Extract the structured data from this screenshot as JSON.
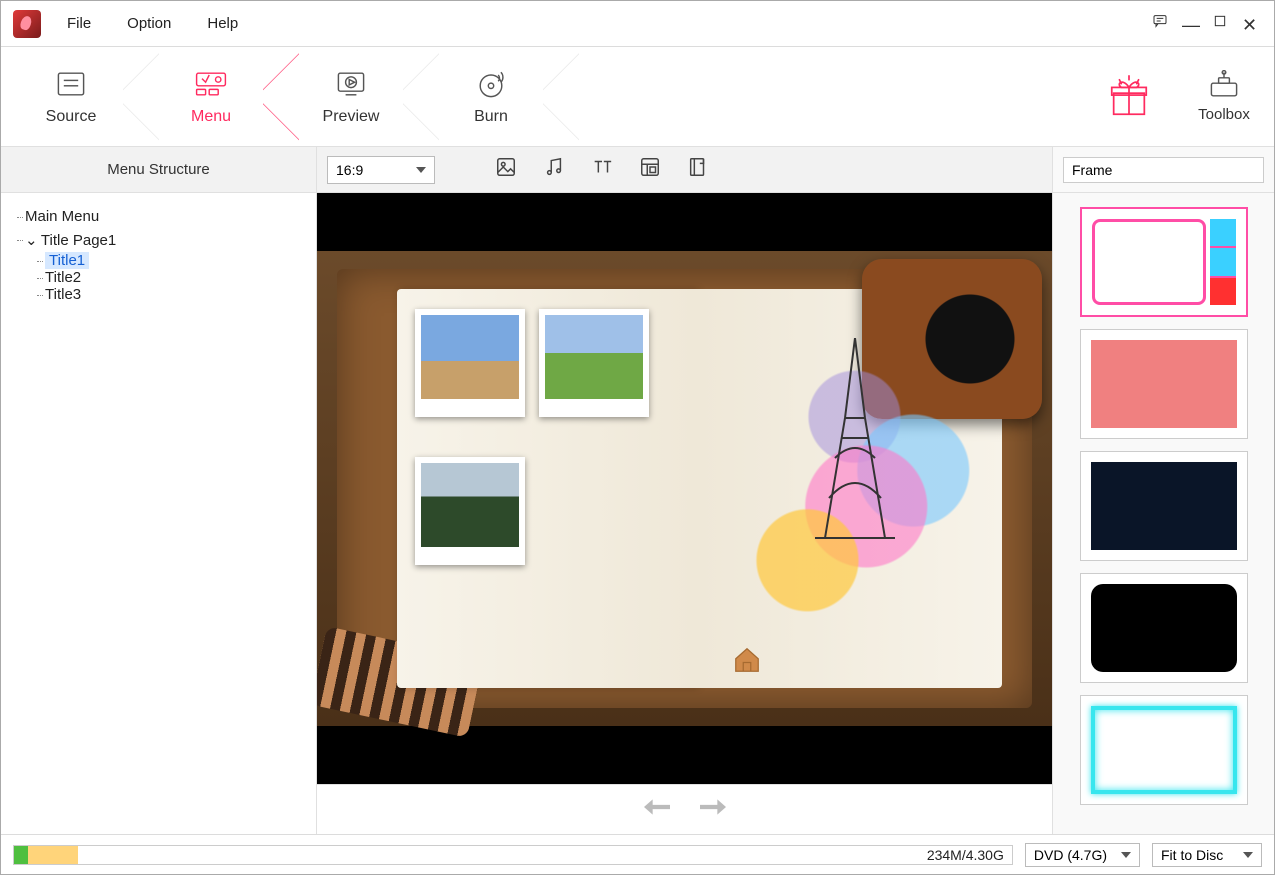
{
  "menubar": {
    "file": "File",
    "option": "Option",
    "help": "Help"
  },
  "steps": {
    "source": "Source",
    "menu": "Menu",
    "preview": "Preview",
    "burn": "Burn",
    "toolbox": "Toolbox"
  },
  "sidebar": {
    "header": "Menu Structure",
    "main_menu": "Main Menu",
    "title_page": "Title Page1",
    "titles": [
      "Title1",
      "Title2",
      "Title3"
    ],
    "selected_index": 0
  },
  "toolbar": {
    "aspect": "16:9"
  },
  "right_panel": {
    "search_value": "Frame"
  },
  "frames": [
    {
      "id": "tv",
      "label": "retro-tv-frame"
    },
    {
      "id": "pink",
      "label": "pink-solid-frame"
    },
    {
      "id": "navy",
      "label": "navy-solid-frame"
    },
    {
      "id": "blackr",
      "label": "black-rounded-frame"
    },
    {
      "id": "cyan",
      "label": "cyan-glow-frame"
    }
  ],
  "status": {
    "size_text": "234M/4.30G",
    "disc_type": "DVD (4.7G)",
    "fit_mode": "Fit to Disc"
  }
}
